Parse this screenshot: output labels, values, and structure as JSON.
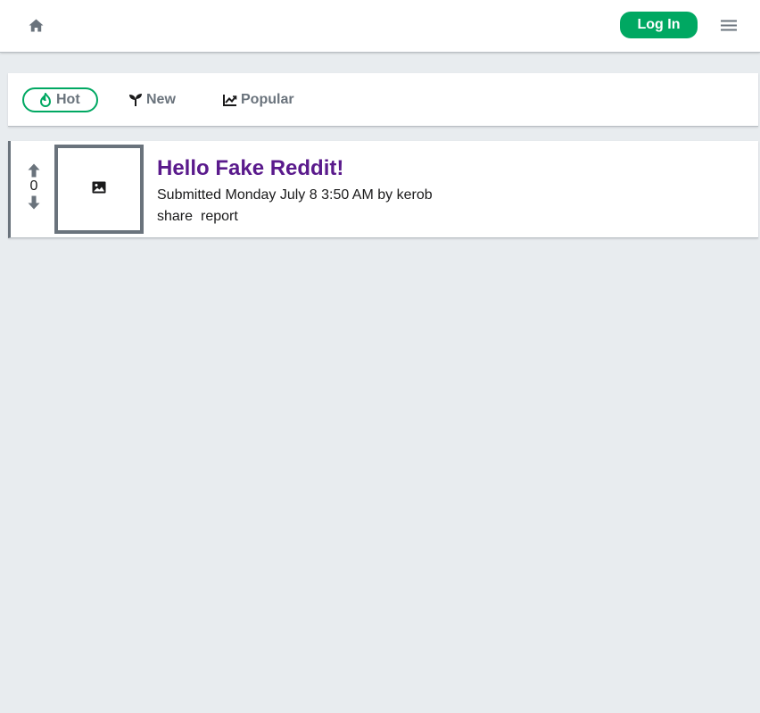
{
  "header": {
    "home_icon": "home-icon",
    "login_label": "Log In",
    "menu_icon": "hamburger-menu-icon"
  },
  "sort": {
    "tabs": [
      {
        "label": "Hot",
        "icon": "flame-icon",
        "active": true
      },
      {
        "label": "New",
        "icon": "sprout-icon",
        "active": false
      },
      {
        "label": "Popular",
        "icon": "trending-chart-icon",
        "active": false
      }
    ]
  },
  "post": {
    "score": "0",
    "thumbnail_icon": "image-icon",
    "title": "Hello Fake Reddit!",
    "submitted": "Submitted Monday July 8 3:50 AM by kerob",
    "actions": {
      "share": "share",
      "report": "report"
    }
  },
  "colors": {
    "accent": "#00a862",
    "title": "#5a1a8c",
    "muted": "#6a737c",
    "background": "#e8ecef"
  }
}
